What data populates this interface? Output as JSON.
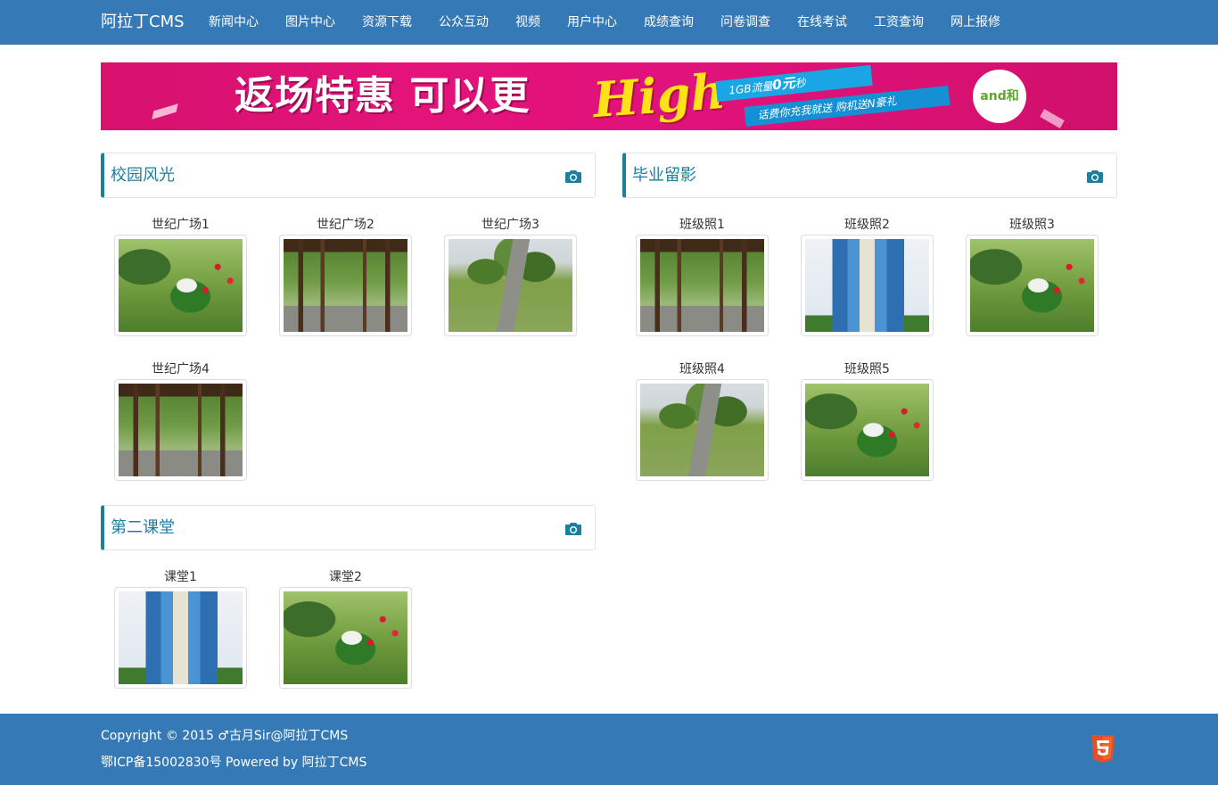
{
  "navbar": {
    "brand": "阿拉丁CMS",
    "items": [
      "新闻中心",
      "图片中心",
      "资源下载",
      "公众互动",
      "视频",
      "用户中心",
      "成绩查询",
      "问卷调查",
      "在线考试",
      "工资查询",
      "网上报修"
    ]
  },
  "banner": {
    "title": "返场特惠 可以更",
    "high": "High",
    "ribbon1_prefix": "1GB流量",
    "ribbon1_bold": "0元",
    "ribbon1_suffix": "秒",
    "ribbon2": "话费你充我就送    购机送N豪礼",
    "logo": "and和"
  },
  "sections": [
    {
      "title": "校园风光",
      "icon": "camera-icon",
      "photos": [
        {
          "label": "世纪广场1",
          "scene": "garden"
        },
        {
          "label": "世纪广场2",
          "scene": "corridor"
        },
        {
          "label": "世纪广场3",
          "scene": "path"
        },
        {
          "label": "世纪广场4",
          "scene": "corridor"
        }
      ]
    },
    {
      "title": "毕业留影",
      "icon": "camera-icon",
      "photos": [
        {
          "label": "班级照1",
          "scene": "corridor"
        },
        {
          "label": "班级照2",
          "scene": "building"
        },
        {
          "label": "班级照3",
          "scene": "garden"
        },
        {
          "label": "班级照4",
          "scene": "path"
        },
        {
          "label": "班级照5",
          "scene": "garden"
        }
      ]
    },
    {
      "title": "第二课堂",
      "icon": "camera-icon",
      "photos": [
        {
          "label": "课堂1",
          "scene": "building"
        },
        {
          "label": "课堂2",
          "scene": "garden"
        }
      ]
    }
  ],
  "footer": {
    "copyright": "Copyright © 2015 ♂古月Sir@阿拉丁CMS",
    "icp": "鄂ICP备15002830号 Powered by 阿拉丁CMS",
    "icon": "html5-icon"
  },
  "colors": {
    "navbar": "#3579b7",
    "accent": "#1b809e",
    "footer": "#3579b7"
  }
}
